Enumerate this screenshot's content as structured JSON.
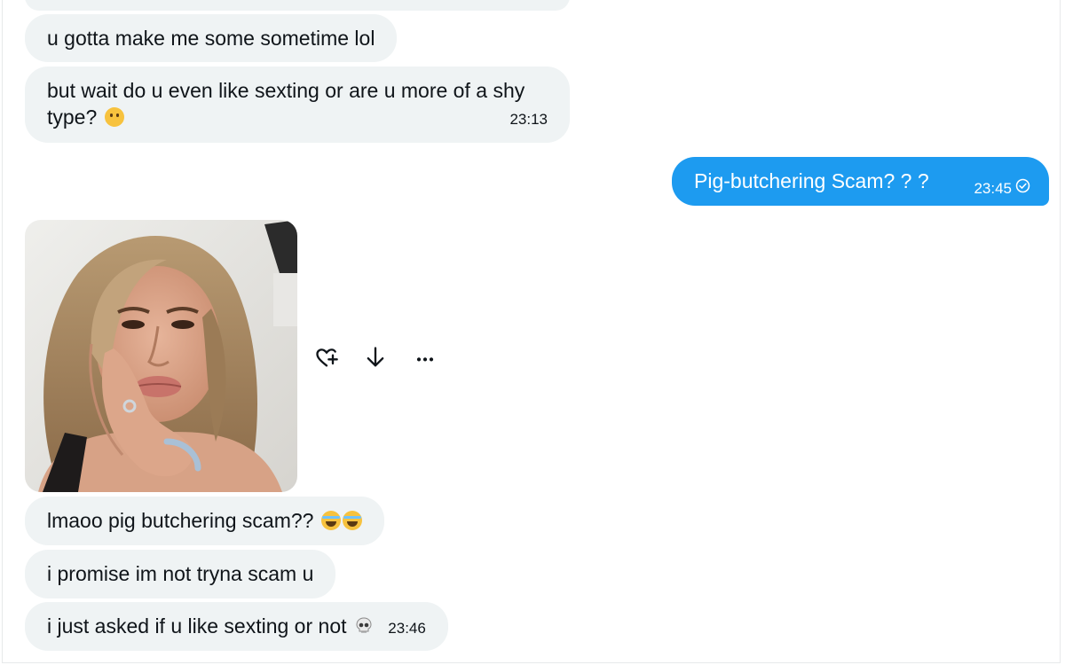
{
  "messages": {
    "m1": {
      "text": "u gotta make me some sometime lol"
    },
    "m2": {
      "line1": "but wait do u even like sexting or are u more of a shy",
      "line2": "type?",
      "emoji": "thinking-face-emoji",
      "time": "23:13"
    },
    "m3": {
      "text": "Pig-butchering Scam? ? ?",
      "time": "23:45",
      "status_icon": "sent-check-icon"
    },
    "m4": {
      "type": "image",
      "description_icon": "photo"
    },
    "m5": {
      "text": "lmaoo pig butchering scam??",
      "emoji": "loudly-crying-face-emoji"
    },
    "m6": {
      "text": "i promise im not tryna scam u"
    },
    "m7": {
      "text": "i just asked if u like sexting or not",
      "emoji": "skull-emoji",
      "time": "23:46"
    }
  },
  "media_actions": {
    "react": "heart-plus-icon",
    "download": "arrow-down-icon",
    "more": "more-dots-icon"
  },
  "colors": {
    "incoming_bubble": "#eff3f4",
    "outgoing_bubble": "#1d9bf0",
    "text": "#0f1419"
  }
}
